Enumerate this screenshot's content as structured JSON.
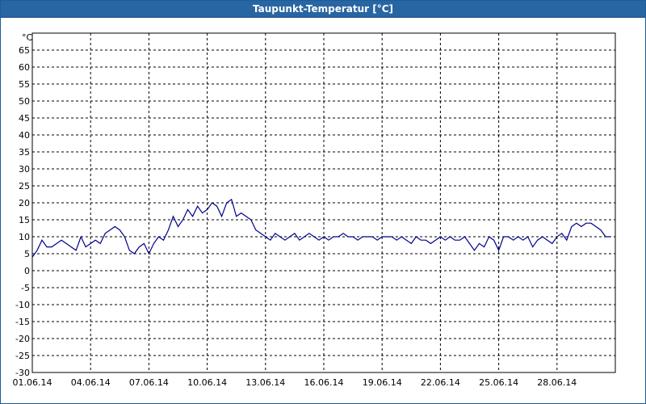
{
  "window": {
    "title": "Taupunkt-Temperatur [°C]"
  },
  "chart_data": {
    "type": "line",
    "title": "Taupunkt-Temperatur [°C]",
    "unit_label": "°C",
    "ylim": [
      -30,
      65
    ],
    "yticks": [
      65,
      60,
      55,
      50,
      45,
      40,
      35,
      30,
      25,
      20,
      15,
      10,
      5,
      0,
      -5,
      -10,
      -15,
      -20,
      -25,
      -30
    ],
    "xlim": [
      "2014-06-01",
      "2014-07-01"
    ],
    "xticks": [
      "01.06.14",
      "04.06.14",
      "07.06.14",
      "10.06.14",
      "13.06.14",
      "16.06.14",
      "19.06.14",
      "22.06.14",
      "25.06.14",
      "28.06.14"
    ],
    "grid": true,
    "line_color": "#00008b",
    "series": [
      {
        "x": [
          "2014-06-01 00:00",
          "2014-06-01 06:00",
          "2014-06-01 12:00",
          "2014-06-01 18:00",
          "2014-06-02 00:00",
          "2014-06-02 06:00",
          "2014-06-02 12:00",
          "2014-06-02 18:00",
          "2014-06-03 00:00",
          "2014-06-03 06:00",
          "2014-06-03 12:00",
          "2014-06-03 18:00",
          "2014-06-04 00:00",
          "2014-06-04 06:00",
          "2014-06-04 12:00",
          "2014-06-04 18:00",
          "2014-06-05 00:00",
          "2014-06-05 06:00",
          "2014-06-05 12:00",
          "2014-06-05 18:00",
          "2014-06-06 00:00",
          "2014-06-06 06:00",
          "2014-06-06 12:00",
          "2014-06-06 18:00",
          "2014-06-07 00:00",
          "2014-06-07 06:00",
          "2014-06-07 12:00",
          "2014-06-07 18:00",
          "2014-06-08 00:00",
          "2014-06-08 06:00",
          "2014-06-08 12:00",
          "2014-06-08 18:00",
          "2014-06-09 00:00",
          "2014-06-09 06:00",
          "2014-06-09 12:00",
          "2014-06-09 18:00",
          "2014-06-10 00:00",
          "2014-06-10 06:00",
          "2014-06-10 12:00",
          "2014-06-10 18:00",
          "2014-06-11 00:00",
          "2014-06-11 06:00",
          "2014-06-11 12:00",
          "2014-06-11 18:00",
          "2014-06-12 00:00",
          "2014-06-12 06:00",
          "2014-06-12 12:00",
          "2014-06-12 18:00",
          "2014-06-13 00:00",
          "2014-06-13 06:00",
          "2014-06-13 12:00",
          "2014-06-13 18:00",
          "2014-06-14 00:00",
          "2014-06-14 06:00",
          "2014-06-14 12:00",
          "2014-06-14 18:00",
          "2014-06-15 00:00",
          "2014-06-15 06:00",
          "2014-06-15 12:00",
          "2014-06-15 18:00",
          "2014-06-16 00:00",
          "2014-06-16 06:00",
          "2014-06-16 12:00",
          "2014-06-16 18:00",
          "2014-06-17 00:00",
          "2014-06-17 06:00",
          "2014-06-17 12:00",
          "2014-06-17 18:00",
          "2014-06-18 00:00",
          "2014-06-18 06:00",
          "2014-06-18 12:00",
          "2014-06-18 18:00",
          "2014-06-19 00:00",
          "2014-06-19 06:00",
          "2014-06-19 12:00",
          "2014-06-19 18:00",
          "2014-06-20 00:00",
          "2014-06-20 06:00",
          "2014-06-20 12:00",
          "2014-06-20 18:00",
          "2014-06-21 00:00",
          "2014-06-21 06:00",
          "2014-06-21 12:00",
          "2014-06-21 18:00",
          "2014-06-22 00:00",
          "2014-06-22 06:00",
          "2014-06-22 12:00",
          "2014-06-22 18:00",
          "2014-06-23 00:00",
          "2014-06-23 06:00",
          "2014-06-23 12:00",
          "2014-06-23 18:00",
          "2014-06-24 00:00",
          "2014-06-24 06:00",
          "2014-06-24 12:00",
          "2014-06-24 18:00",
          "2014-06-25 00:00",
          "2014-06-25 06:00",
          "2014-06-25 12:00",
          "2014-06-25 18:00",
          "2014-06-26 00:00",
          "2014-06-26 06:00",
          "2014-06-26 12:00",
          "2014-06-26 18:00",
          "2014-06-27 00:00",
          "2014-06-27 06:00",
          "2014-06-27 12:00",
          "2014-06-27 18:00",
          "2014-06-28 00:00",
          "2014-06-28 06:00",
          "2014-06-28 12:00",
          "2014-06-28 18:00",
          "2014-06-29 00:00",
          "2014-06-29 06:00",
          "2014-06-29 12:00",
          "2014-06-29 18:00",
          "2014-06-30 00:00",
          "2014-06-30 06:00",
          "2014-06-30 12:00",
          "2014-06-30 18:00"
        ],
        "values": [
          4,
          6,
          9,
          7,
          7,
          8,
          9,
          8,
          7,
          6,
          10,
          7,
          8,
          9,
          8,
          11,
          12,
          13,
          12,
          10,
          6,
          5,
          7,
          8,
          5,
          8,
          10,
          9,
          12,
          16,
          13,
          15,
          18,
          16,
          19,
          17,
          18,
          20,
          19,
          16,
          20,
          21,
          16,
          17,
          16,
          15,
          12,
          11,
          10,
          9,
          11,
          10,
          9,
          10,
          11,
          9,
          10,
          11,
          10,
          9,
          10,
          9,
          10,
          10,
          11,
          10,
          10,
          9,
          10,
          10,
          10,
          9,
          10,
          10,
          10,
          9,
          10,
          9,
          8,
          10,
          9,
          9,
          8,
          9,
          10,
          9,
          10,
          9,
          9,
          10,
          8,
          6,
          8,
          7,
          10,
          9,
          6,
          10,
          10,
          9,
          10,
          9,
          10,
          7,
          9,
          10,
          9,
          8,
          10,
          11,
          9,
          13,
          14,
          13,
          14,
          14,
          13,
          12,
          10,
          10
        ]
      }
    ]
  }
}
